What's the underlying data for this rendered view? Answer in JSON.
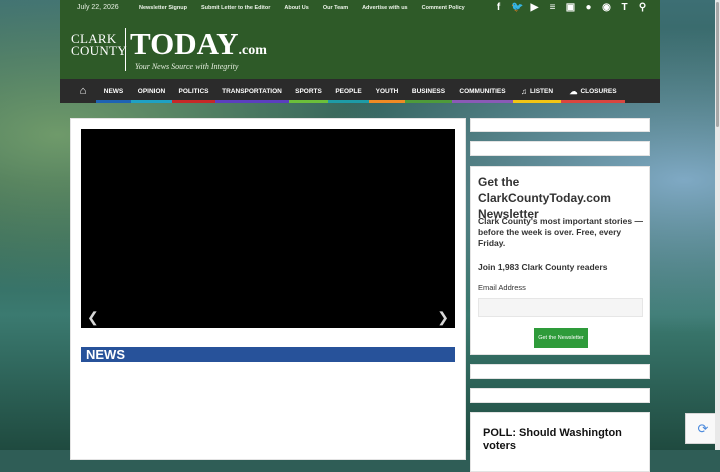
{
  "topbar": {
    "date": "July 22, 2026",
    "links": [
      "Newsletter Signup",
      "Submit Letter to the Editor",
      "About Us",
      "Our Team",
      "Advertise with us",
      "Comment Policy"
    ],
    "social_icons": [
      "facebook-icon",
      "twitter-icon",
      "youtube-icon",
      "rss-icon",
      "instagram-icon",
      "spotify-icon",
      "podcast-icon",
      "truth-social-icon",
      "search-icon"
    ]
  },
  "logo": {
    "clark": "CLARK",
    "county": "COUNTY",
    "today": "TODAY",
    "com": ".com",
    "tagline": "Your News Source with Integrity"
  },
  "nav": {
    "items": [
      {
        "label": "NEWS",
        "stripe": "#1e63b4"
      },
      {
        "label": "OPINION",
        "stripe": "#1fa1c4"
      },
      {
        "label": "POLITICS",
        "stripe": "#c62828"
      },
      {
        "label": "TRANSPORTATION",
        "stripe": "#5b3fbf"
      },
      {
        "label": "SPORTS",
        "stripe": "#6bbf3a"
      },
      {
        "label": "PEOPLE",
        "stripe": "#1e9ba6"
      },
      {
        "label": "YOUTH",
        "stripe": "#f08a24"
      },
      {
        "label": "BUSINESS",
        "stripe": "#4e9b3a"
      },
      {
        "label": "COMMUNITIES",
        "stripe": "#8a5ab6"
      },
      {
        "label": "LISTEN",
        "stripe": "#f2c514"
      },
      {
        "label": "CLOSURES",
        "stripe": "#d9453f"
      }
    ]
  },
  "main": {
    "section_title": "NEWS"
  },
  "newsletter": {
    "title": "Get the ClarkCountyToday.com Newsletter",
    "description": "Clark County's most important stories — before the week is over. Free, every Friday.",
    "join": "Join 1,983 Clark County readers",
    "email_label": "Email Address",
    "email_placeholder": "",
    "button": "Get the Newsletter"
  },
  "poll": {
    "title": "POLL: Should Washington voters"
  },
  "colors": {
    "header_green": "#2e5a28",
    "nav_dark": "#2b2b2b",
    "news_blue": "#27529a",
    "button_green": "#2e9b3a"
  }
}
